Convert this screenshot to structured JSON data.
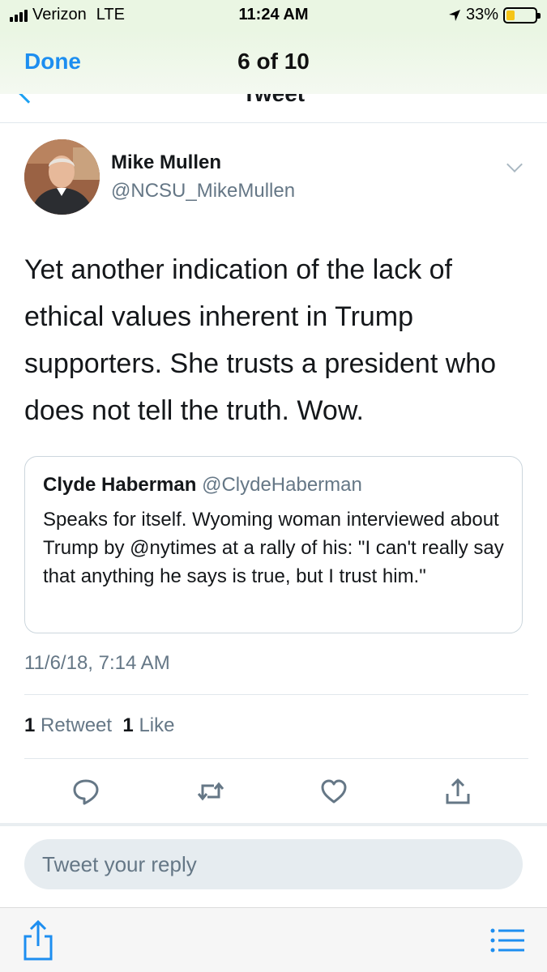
{
  "status_bar": {
    "carrier": "Verizon",
    "network": "LTE",
    "time": "11:24 AM",
    "battery_percent": "33%",
    "battery_level": 0.33
  },
  "viewer": {
    "done_label": "Done",
    "page_counter": "6 of 10"
  },
  "nav": {
    "title": "Tweet"
  },
  "tweet": {
    "author_name": "Mike Mullen",
    "author_handle": "@NCSU_MikeMullen",
    "text": "Yet another indication of the lack of ethical values inherent in Trump supporters.  She trusts a president who does not tell the truth.  Wow.",
    "timestamp": "11/6/18, 7:14 AM",
    "retweet_count": "1",
    "retweet_label": "Retweet",
    "like_count": "1",
    "like_label": "Like"
  },
  "quoted_tweet": {
    "author_name": "Clyde Haberman",
    "author_handle": "@ClydeHaberman",
    "text": "Speaks for itself. Wyoming woman interviewed about Trump by @nytimes at a rally of his: \"I can't really say that anything he says is true, but I trust him.\""
  },
  "actions": {
    "icons": [
      "reply-icon",
      "retweet-icon",
      "like-icon",
      "share-icon"
    ]
  },
  "reply": {
    "placeholder": "Tweet your reply"
  },
  "colors": {
    "accent": "#1DA1F2",
    "ios_blue": "#1D8EF0",
    "secondary_text": "#657786",
    "header_tint": "#EAF6E3",
    "battery": "#F5C518"
  }
}
